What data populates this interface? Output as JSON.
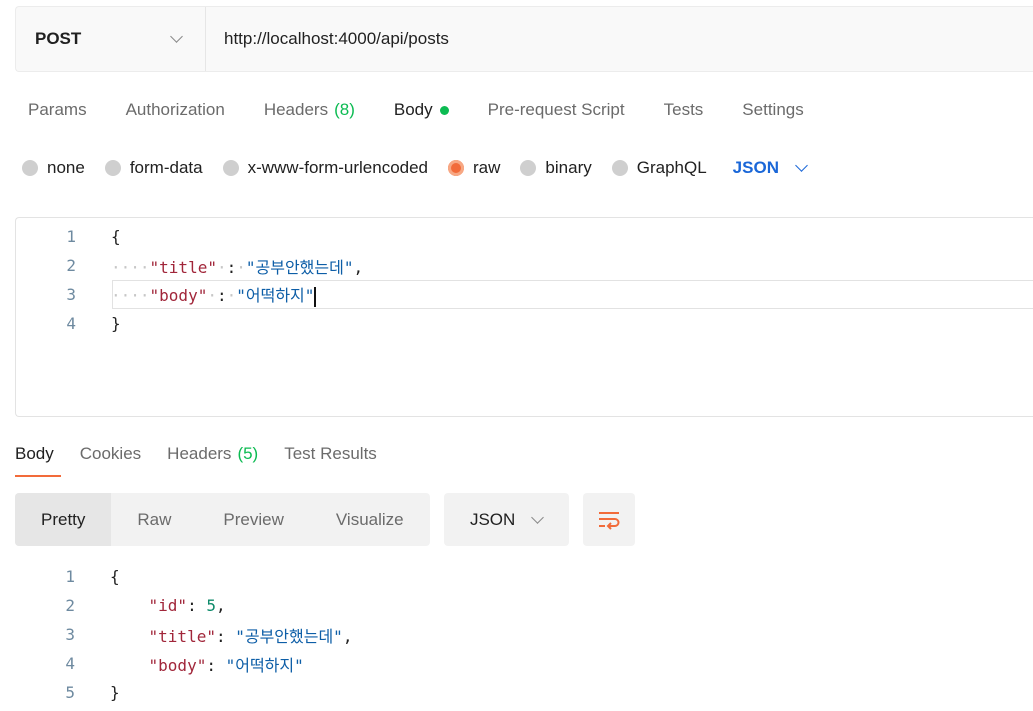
{
  "request": {
    "method": "POST",
    "url": "http://localhost:4000/api/posts"
  },
  "request_tabs": [
    {
      "label": "Params"
    },
    {
      "label": "Authorization"
    },
    {
      "label": "Headers",
      "count": "(8)"
    },
    {
      "label": "Body",
      "active": true
    },
    {
      "label": "Pre-request Script"
    },
    {
      "label": "Tests"
    },
    {
      "label": "Settings"
    }
  ],
  "body_types": [
    {
      "label": "none"
    },
    {
      "label": "form-data"
    },
    {
      "label": "x-www-form-urlencoded"
    },
    {
      "label": "raw",
      "selected": true
    },
    {
      "label": "binary"
    },
    {
      "label": "GraphQL"
    }
  ],
  "body_format": "JSON",
  "request_body": {
    "line_numbers": [
      "1",
      "2",
      "3",
      "4"
    ],
    "open": "{",
    "close": "}",
    "title_key": "\"title\"",
    "title_value": "\"공부안했는데\"",
    "body_key": "\"body\"",
    "body_value": "\"어떡하지\""
  },
  "response_tabs": [
    {
      "label": "Body",
      "active": true
    },
    {
      "label": "Cookies"
    },
    {
      "label": "Headers",
      "count": "(5)"
    },
    {
      "label": "Test Results"
    }
  ],
  "response_view_modes": [
    "Pretty",
    "Raw",
    "Preview",
    "Visualize"
  ],
  "response_format": "JSON",
  "response_body": {
    "line_numbers": [
      "1",
      "2",
      "3",
      "4",
      "5"
    ],
    "open": "{",
    "close": "}",
    "id_key": "\"id\"",
    "id_value": "5",
    "title_key": "\"title\"",
    "title_value": "\"공부안했는데\"",
    "body_key": "\"body\"",
    "body_value": "\"어떡하지\""
  },
  "icons": {
    "method_dropdown": "chevron-down-icon",
    "wrap": "word-wrap-icon"
  },
  "colors": {
    "accent": "#f26b3a",
    "count_green": "#0cbb52",
    "json_blue": "#1a67d8",
    "json_key": "#a1263a",
    "json_string": "#0d5ea7"
  }
}
